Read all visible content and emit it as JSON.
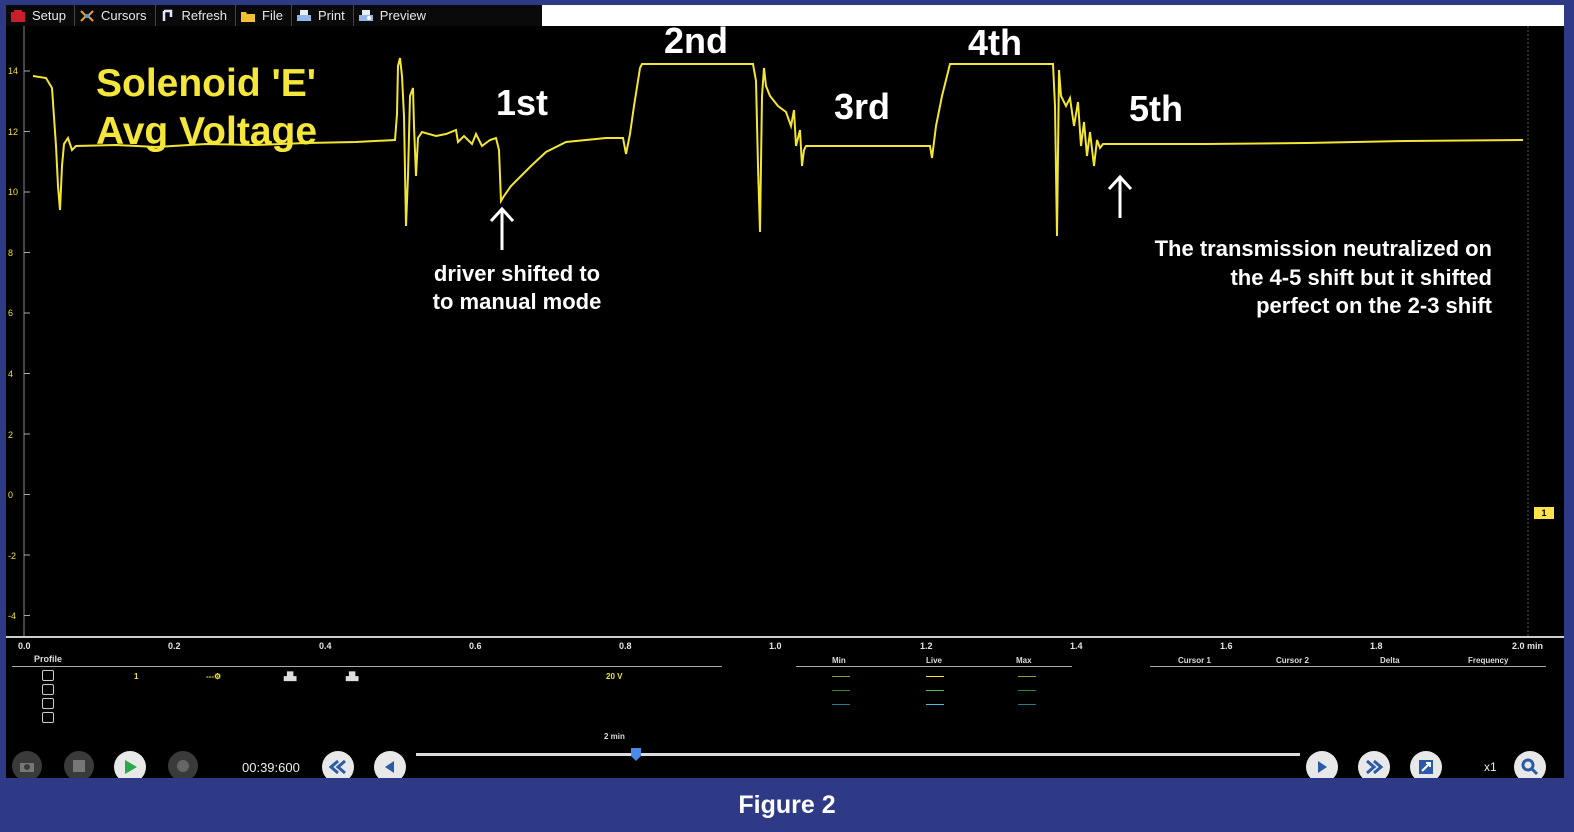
{
  "toolbar": {
    "items": [
      {
        "label": "Setup",
        "icon": "setup-icon"
      },
      {
        "label": "Cursors",
        "icon": "cursors-icon"
      },
      {
        "label": "Refresh",
        "icon": "refresh-icon"
      },
      {
        "label": "File",
        "icon": "folder-icon"
      },
      {
        "label": "Print",
        "icon": "print-icon"
      },
      {
        "label": "Preview",
        "icon": "preview-icon"
      }
    ]
  },
  "plot": {
    "title_line1": "Solenoid 'E'",
    "title_line2": "Avg Voltage",
    "y_ticks": [
      "14",
      "12",
      "10",
      "8",
      "6",
      "4",
      "2",
      "0",
      "-2",
      "-4"
    ],
    "x_ticks": [
      "0.0",
      "0.2",
      "0.4",
      "0.6",
      "0.8",
      "1.0",
      "1.2",
      "1.4",
      "1.6",
      "1.8",
      "2.0 min"
    ],
    "channel_marker": "1",
    "trace_color": "#f2e633",
    "gear_labels": {
      "first": "1st",
      "second": "2nd",
      "third": "3rd",
      "fourth": "4th",
      "fifth": "5th"
    },
    "note_manual": [
      "driver shifted to",
      "to manual mode"
    ],
    "note_neutral": [
      "The transmission neutralized on",
      "the 4-5 shift but it shifted",
      "perfect on the 2-3 shift"
    ]
  },
  "panel": {
    "profile_label": "Profile",
    "channel_num": "1",
    "scale": "20 V",
    "stats_headers": [
      "Min",
      "Live",
      "Max"
    ],
    "cursor_headers": [
      "Cursor 1",
      "Cursor 2",
      "Delta",
      "Frequency"
    ],
    "timebase": "2 min",
    "timestamp": "00:39:600",
    "zoom": "x1",
    "slider_position": 0.1
  },
  "caption": "Figure 2"
}
